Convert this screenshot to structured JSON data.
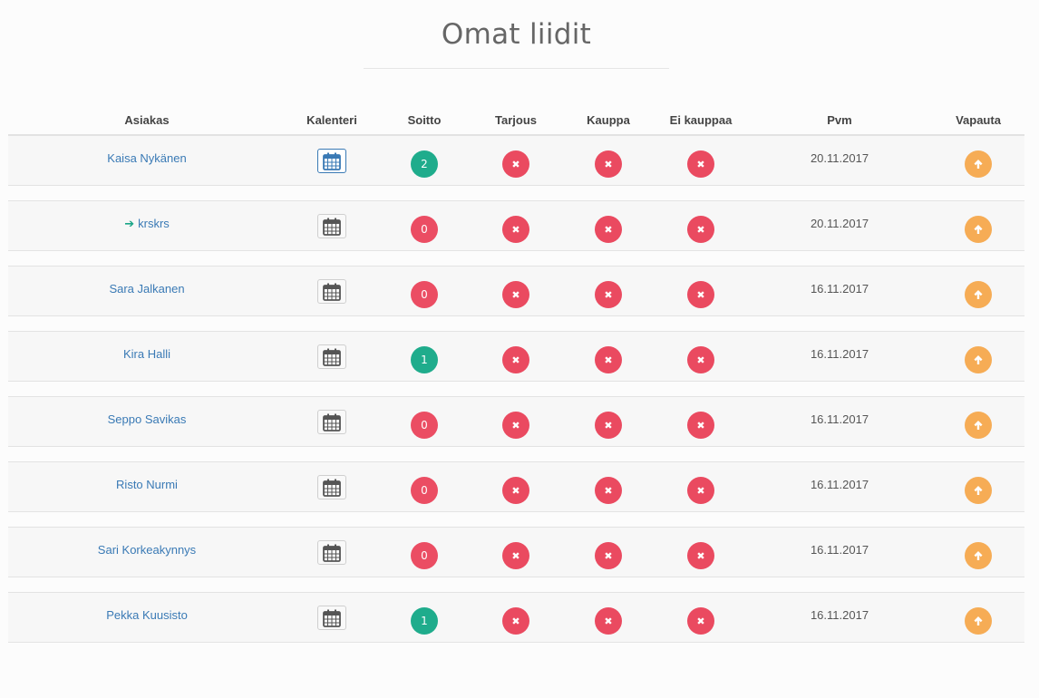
{
  "page": {
    "title": "Omat liidit"
  },
  "table": {
    "headers": {
      "customer": "Asiakas",
      "calendar": "Kalenteri",
      "call": "Soitto",
      "offer": "Tarjous",
      "deal": "Kauppa",
      "no_deal": "Ei kauppaa",
      "date": "Pvm",
      "release": "Vapauta"
    },
    "rows": [
      {
        "name": "Kaisa Nykänen",
        "has_arrow": false,
        "calendar_active": true,
        "calls": "2",
        "calls_color": "#1fac8c",
        "offer": "✖",
        "deal": "✖",
        "no_deal": "✖",
        "date": "20.11.2017"
      },
      {
        "name": "krskrs",
        "has_arrow": true,
        "calendar_active": false,
        "calls": "0",
        "calls_color": "#eb4d63",
        "offer": "✖",
        "deal": "✖",
        "no_deal": "✖",
        "date": "20.11.2017"
      },
      {
        "name": "Sara Jalkanen",
        "has_arrow": false,
        "calendar_active": false,
        "calls": "0",
        "calls_color": "#eb4d63",
        "offer": "✖",
        "deal": "✖",
        "no_deal": "✖",
        "date": "16.11.2017"
      },
      {
        "name": "Kira Halli",
        "has_arrow": false,
        "calendar_active": false,
        "calls": "1",
        "calls_color": "#1fac8c",
        "offer": "✖",
        "deal": "✖",
        "no_deal": "✖",
        "date": "16.11.2017"
      },
      {
        "name": "Seppo Savikas",
        "has_arrow": false,
        "calendar_active": false,
        "calls": "0",
        "calls_color": "#eb4d63",
        "offer": "✖",
        "deal": "✖",
        "no_deal": "✖",
        "date": "16.11.2017"
      },
      {
        "name": "Risto Nurmi",
        "has_arrow": false,
        "calendar_active": false,
        "calls": "0",
        "calls_color": "#eb4d63",
        "offer": "✖",
        "deal": "✖",
        "no_deal": "✖",
        "date": "16.11.2017"
      },
      {
        "name": "Sari Korkeakynnys",
        "has_arrow": false,
        "calendar_active": false,
        "calls": "0",
        "calls_color": "#eb4d63",
        "offer": "✖",
        "deal": "✖",
        "no_deal": "✖",
        "date": "16.11.2017"
      },
      {
        "name": "Pekka Kuusisto",
        "has_arrow": false,
        "calendar_active": false,
        "calls": "1",
        "calls_color": "#1fac8c",
        "offer": "✖",
        "deal": "✖",
        "no_deal": "✖",
        "date": "16.11.2017"
      }
    ]
  },
  "colors": {
    "link": "#3a7ab5",
    "green": "#1fac8c",
    "red": "#eb4d63",
    "orange": "#f6ac55",
    "arrow": "#1aa587"
  },
  "icons": {
    "calendar": "calendar-icon",
    "remove": "remove-icon",
    "release": "arrow-up-icon",
    "row_marker": "arrow-right-icon"
  }
}
